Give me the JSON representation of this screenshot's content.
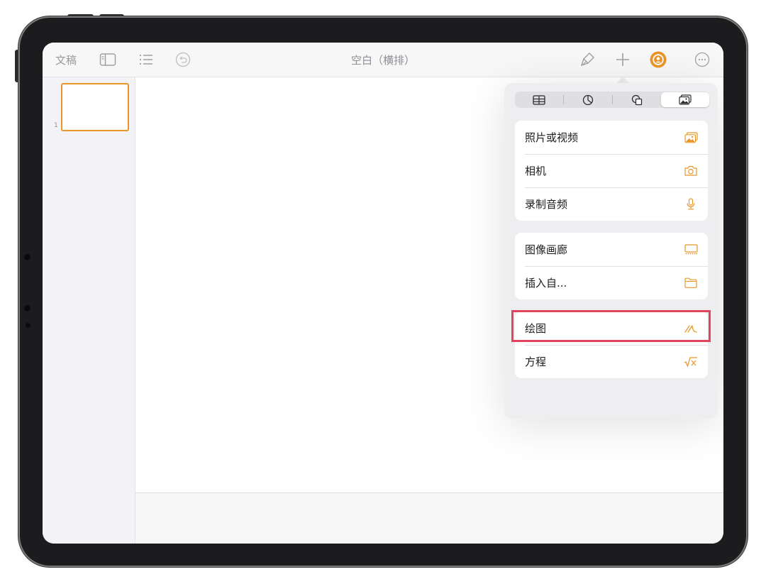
{
  "toolbar": {
    "documents_label": "文稿",
    "title": "空白（横排）"
  },
  "navigator": {
    "slides": [
      {
        "number": "1"
      }
    ]
  },
  "insert_popover": {
    "tabs": [
      {
        "icon": "table-icon"
      },
      {
        "icon": "chart-icon"
      },
      {
        "icon": "shapes-icon"
      },
      {
        "icon": "media-icon",
        "selected": true
      }
    ],
    "groups": [
      [
        {
          "label": "照片或视频",
          "icon": "photo-icon"
        },
        {
          "label": "相机",
          "icon": "camera-icon"
        },
        {
          "label": "录制音频",
          "icon": "microphone-icon"
        }
      ],
      [
        {
          "label": "图像画廊",
          "icon": "image-gallery-icon"
        },
        {
          "label": "插入自...",
          "icon": "folder-icon"
        }
      ],
      [
        {
          "label": "绘图",
          "icon": "drawing-icon",
          "highlighted": true
        },
        {
          "label": "方程",
          "icon": "equation-icon"
        }
      ]
    ]
  },
  "colors": {
    "accent": "#e8962a",
    "highlight_box": "#e1455c"
  }
}
